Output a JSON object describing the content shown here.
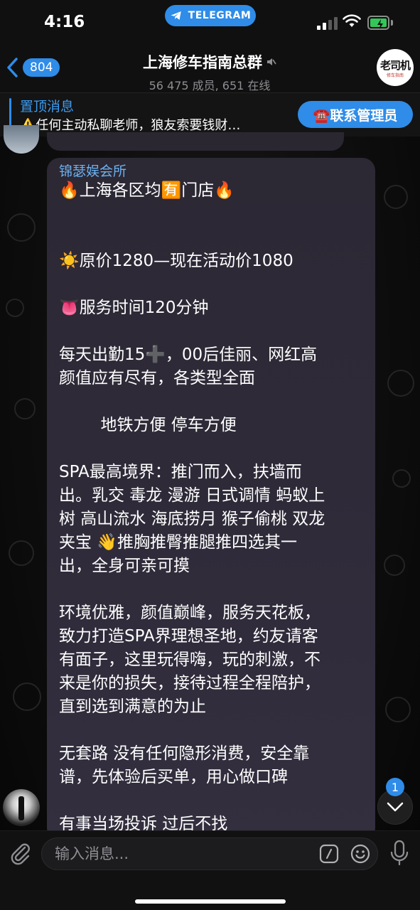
{
  "status_bar": {
    "time": "4:16",
    "app_pill": "TELEGRAM"
  },
  "header": {
    "back_count": "804",
    "title": "上海修车指南总群",
    "subtitle": "56 475 成员, 651 在线",
    "avatar_text": "老司机",
    "avatar_subtext": "修车指南",
    "muted": true
  },
  "pinned": {
    "title": "置顶消息",
    "text": "⚠️任何主动私聊老师，狼友索要钱财…",
    "button_label": "☎️联系管理员"
  },
  "message": {
    "sender": "锦瑟娱会所",
    "lines": [
      "🔥上海各区均🈶门店🔥",
      "",
      "",
      "☀️原价1280—现在活动价1080",
      "",
      "👅服务时间120分钟",
      "",
      "每天出勤15➕，00后佳丽、网红高",
      "颜值应有尽有，各类型全面",
      "",
      "        地铁方便 停车方便",
      "",
      "SPA最高境界：推门而入，扶墙而",
      "出。乳交 毒龙 漫游 日式调情 蚂蚁上",
      "树 高山流水 海底捞月 猴子偷桃 双龙",
      "夹宝 👋推胸推臀推腿推四选其一",
      "出，全身可亲可摸",
      "",
      "环境优雅，颜值巅峰，服务天花板，",
      "致力打造SPA界理想圣地，约友请客",
      "有面子，这里玩得嗨，玩的刺激，不",
      "来是你的损失，接待过程全程陪护，",
      "直到选到满意的为止",
      "",
      "无套路 没有任何隐形消费，安全靠",
      "谱，先体验后买单，用心做口碑",
      "",
      "有事当场投诉 过后不找"
    ]
  },
  "scroll_down": {
    "badge": "1"
  },
  "input": {
    "placeholder": "输入消息..."
  },
  "colors": {
    "accent": "#2f8ce8",
    "link": "#3d9bf0",
    "bubble": "#2e2a38"
  }
}
